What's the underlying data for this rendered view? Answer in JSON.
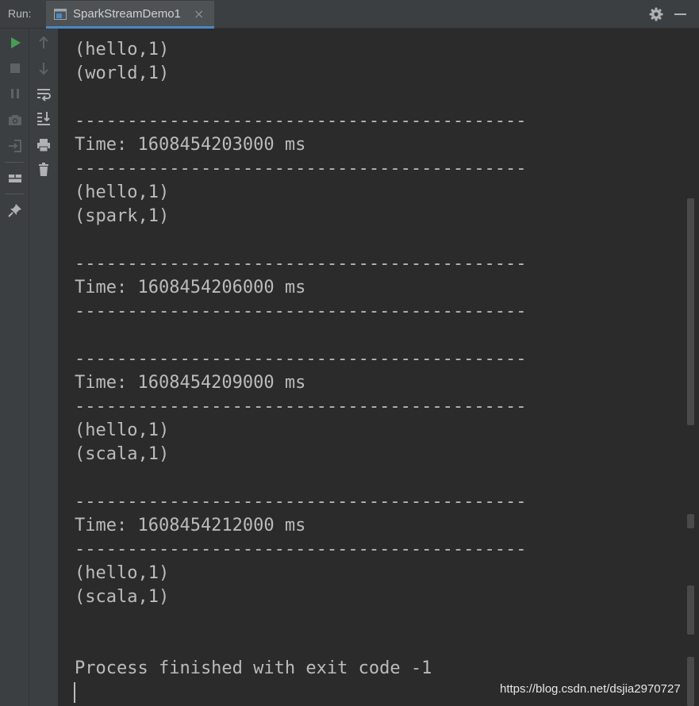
{
  "titlebar": {
    "run_label": "Run:",
    "tab_title": "SparkStreamDemo1",
    "tab_close": "×"
  },
  "toolbar": {
    "outer_icons": [
      "run-icon",
      "stop-icon",
      "pause-icon",
      "screenshot-icon",
      "exit-icon",
      "layout-icon",
      "pin-icon"
    ],
    "inner_icons": [
      "arrow-up-icon",
      "arrow-down-icon",
      "soft-wrap-icon",
      "scroll-to-end-icon",
      "print-icon",
      "trash-icon"
    ]
  },
  "console": {
    "lines": [
      "(hello,1)",
      "(world,1)",
      "",
      "-------------------------------------------",
      "Time: 1608454203000 ms",
      "-------------------------------------------",
      "(hello,1)",
      "(spark,1)",
      "",
      "-------------------------------------------",
      "Time: 1608454206000 ms",
      "-------------------------------------------",
      "",
      "-------------------------------------------",
      "Time: 1608454209000 ms",
      "-------------------------------------------",
      "(hello,1)",
      "(scala,1)",
      "",
      "-------------------------------------------",
      "Time: 1608454212000 ms",
      "-------------------------------------------",
      "(hello,1)",
      "(scala,1)",
      "",
      "",
      "Process finished with exit code -1"
    ]
  },
  "watermark": "https://blog.csdn.net/dsjia2970727",
  "colors": {
    "background": "#2b2b2b",
    "toolbar": "#3c3f41",
    "text": "#bbbbbb",
    "run_green": "#499c54",
    "accent": "#4a88c7"
  }
}
